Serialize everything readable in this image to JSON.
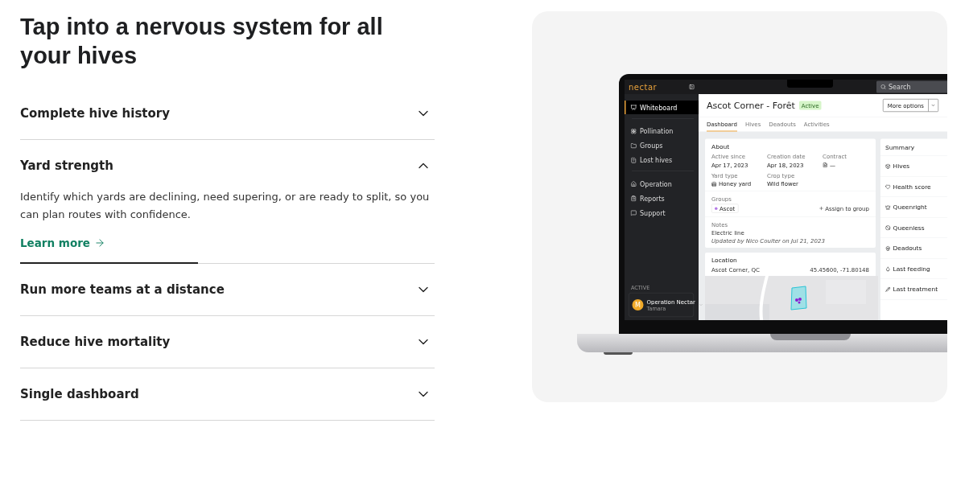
{
  "heading": "Tap into a nervous system for all your hives",
  "accordion": [
    {
      "title": "Complete hive history",
      "expanded": false
    },
    {
      "title": "Yard strength",
      "expanded": true,
      "body": "Identify which yards are declining, need supering, or are ready to split, so you can plan routes with confidence.",
      "link": "Learn more",
      "progress": {
        "level": 0.43
      }
    },
    {
      "title": "Run more teams at a distance",
      "expanded": false
    },
    {
      "title": "Reduce hive mortality",
      "expanded": false
    },
    {
      "title": "Single dashboard",
      "expanded": false
    }
  ],
  "app": {
    "logo": "nectar",
    "search": {
      "placeholder": "Search"
    },
    "sidebar": {
      "sections": [
        [
          {
            "label": "Whiteboard",
            "selected": true
          }
        ],
        [
          {
            "label": "Pollination",
            "selected": false
          },
          {
            "label": "Groups",
            "selected": false
          },
          {
            "label": "Lost hives",
            "selected": false
          }
        ],
        [
          {
            "label": "Operation",
            "selected": false
          },
          {
            "label": "Reports",
            "selected": false
          },
          {
            "label": "Support",
            "selected": false
          }
        ]
      ],
      "account": {
        "caption": "ACTIVE",
        "initial": "M",
        "name": "Operation Nectar",
        "role": "Tamara"
      }
    },
    "header": {
      "title": "Ascot Corner - Forêt",
      "status": "Active",
      "button": "More options"
    },
    "tabs": [
      {
        "label": "Dashboard",
        "selected": true
      },
      {
        "label": "Hives",
        "selected": false
      },
      {
        "label": "Deadouts",
        "selected": false
      },
      {
        "label": "Activities",
        "selected": false
      }
    ],
    "about": {
      "title": "About",
      "fields": [
        {
          "label": "Active since",
          "value": "Apr 17, 2023"
        },
        {
          "label": "Creation date",
          "value": "Apr 18, 2023"
        },
        {
          "label": "Contract",
          "value": "—"
        },
        {
          "label": "Yard type",
          "value": "Honey yard"
        },
        {
          "label": "Crop type",
          "value": "Wild flower"
        }
      ],
      "groups": {
        "label": "Groups",
        "chip": {
          "label": "Ascot",
          "color": "#b57be6"
        },
        "action": "Assign to group"
      },
      "notes": {
        "label": "Notes",
        "text": "Electric line",
        "updated": "Updated by Nico Coulter on Jul 21, 2023"
      }
    },
    "location": {
      "title": "Location",
      "place": "Ascot Corner, QC",
      "coords": "45.45600, -71.80148"
    },
    "summary": {
      "title": "Summary",
      "rows": [
        "Hives",
        "Health score",
        "Queenright",
        "Queenless",
        "Deadouts",
        "Last feeding",
        "Last treatment"
      ]
    }
  }
}
